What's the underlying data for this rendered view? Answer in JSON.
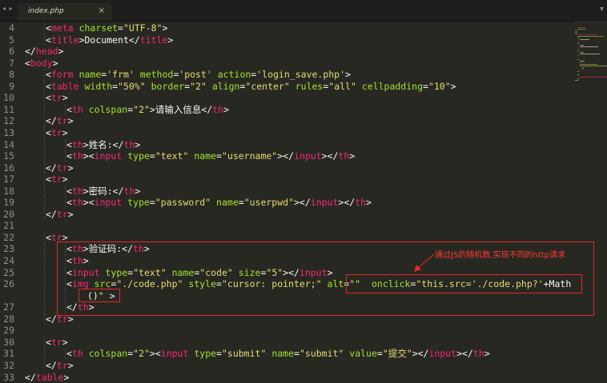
{
  "tab": {
    "label": "index.php",
    "close": "×"
  },
  "window": {
    "nav": "◂ ▸",
    "menu": "▾"
  },
  "colors": {
    "background": "#272822",
    "tag": "#f92672",
    "attr": "#a6e22e",
    "string": "#e6db74",
    "text": "#f8f8f2",
    "line_number": "#8f908a",
    "annotation": "#e8262a"
  },
  "annotation": {
    "text": "通过JS的随机数,实现不同的http请求"
  },
  "lines": [
    {
      "n": "4",
      "indent": 1,
      "tokens": [
        [
          "p",
          "<"
        ],
        [
          "t",
          "meta"
        ],
        [
          "w",
          " "
        ],
        [
          "a",
          "charset"
        ],
        [
          "p",
          "="
        ],
        [
          "s",
          "\"UTF-8\""
        ],
        [
          "p",
          ">"
        ]
      ]
    },
    {
      "n": "5",
      "indent": 1,
      "tokens": [
        [
          "p",
          "<"
        ],
        [
          "t",
          "title"
        ],
        [
          "p",
          ">"
        ],
        [
          "w",
          "Document"
        ],
        [
          "p",
          "</"
        ],
        [
          "t",
          "title"
        ],
        [
          "p",
          ">"
        ]
      ]
    },
    {
      "n": "6",
      "indent": 0,
      "tokens": [
        [
          "p",
          "</"
        ],
        [
          "t",
          "head"
        ],
        [
          "p",
          ">"
        ]
      ]
    },
    {
      "n": "7",
      "indent": 0,
      "tokens": [
        [
          "p",
          "<"
        ],
        [
          "t",
          "body"
        ],
        [
          "p",
          ">"
        ]
      ]
    },
    {
      "n": "8",
      "indent": 1,
      "tokens": [
        [
          "p",
          "<"
        ],
        [
          "t",
          "form"
        ],
        [
          "w",
          " "
        ],
        [
          "a",
          "name"
        ],
        [
          "p",
          "="
        ],
        [
          "s",
          "'frm'"
        ],
        [
          "w",
          " "
        ],
        [
          "a",
          "method"
        ],
        [
          "p",
          "="
        ],
        [
          "s",
          "'post'"
        ],
        [
          "w",
          " "
        ],
        [
          "a",
          "action"
        ],
        [
          "p",
          "="
        ],
        [
          "s",
          "'login_save.php'"
        ],
        [
          "p",
          ">"
        ]
      ]
    },
    {
      "n": "9",
      "indent": 1,
      "tokens": [
        [
          "p",
          "<"
        ],
        [
          "t",
          "table"
        ],
        [
          "w",
          " "
        ],
        [
          "a",
          "width"
        ],
        [
          "p",
          "="
        ],
        [
          "s",
          "\"50%\""
        ],
        [
          "w",
          " "
        ],
        [
          "a",
          "border"
        ],
        [
          "p",
          "="
        ],
        [
          "s",
          "\"2\""
        ],
        [
          "w",
          " "
        ],
        [
          "a",
          "align"
        ],
        [
          "p",
          "="
        ],
        [
          "s",
          "\"center\""
        ],
        [
          "w",
          " "
        ],
        [
          "a",
          "rules"
        ],
        [
          "p",
          "="
        ],
        [
          "s",
          "\"all\""
        ],
        [
          "w",
          " "
        ],
        [
          "a",
          "cellpadding"
        ],
        [
          "p",
          "="
        ],
        [
          "s",
          "\"10\""
        ],
        [
          "p",
          ">"
        ]
      ]
    },
    {
      "n": "10",
      "indent": 1,
      "tokens": [
        [
          "p",
          "<"
        ],
        [
          "t",
          "tr"
        ],
        [
          "p",
          ">"
        ]
      ]
    },
    {
      "n": "11",
      "indent": 2,
      "tokens": [
        [
          "p",
          "<"
        ],
        [
          "t",
          "th"
        ],
        [
          "w",
          " "
        ],
        [
          "a",
          "colspan"
        ],
        [
          "p",
          "="
        ],
        [
          "s",
          "\"2\""
        ],
        [
          "p",
          ">"
        ],
        [
          "w",
          "请输入信息"
        ],
        [
          "p",
          "</"
        ],
        [
          "t",
          "th"
        ],
        [
          "p",
          ">"
        ]
      ]
    },
    {
      "n": "12",
      "indent": 1,
      "tokens": [
        [
          "p",
          "</"
        ],
        [
          "t",
          "tr"
        ],
        [
          "p",
          ">"
        ]
      ]
    },
    {
      "n": "13",
      "indent": 1,
      "tokens": [
        [
          "p",
          "<"
        ],
        [
          "t",
          "tr"
        ],
        [
          "p",
          ">"
        ]
      ]
    },
    {
      "n": "14",
      "indent": 2,
      "tokens": [
        [
          "p",
          "<"
        ],
        [
          "t",
          "th"
        ],
        [
          "p",
          ">"
        ],
        [
          "w",
          "姓名:"
        ],
        [
          "p",
          "</"
        ],
        [
          "t",
          "th"
        ],
        [
          "p",
          ">"
        ]
      ]
    },
    {
      "n": "15",
      "indent": 2,
      "tokens": [
        [
          "p",
          "<"
        ],
        [
          "t",
          "th"
        ],
        [
          "p",
          "><"
        ],
        [
          "t",
          "input"
        ],
        [
          "w",
          " "
        ],
        [
          "a",
          "type"
        ],
        [
          "p",
          "="
        ],
        [
          "s",
          "\"text\""
        ],
        [
          "w",
          " "
        ],
        [
          "a",
          "name"
        ],
        [
          "p",
          "="
        ],
        [
          "s",
          "\"username\""
        ],
        [
          "p",
          "></"
        ],
        [
          "t",
          "input"
        ],
        [
          "p",
          "></"
        ],
        [
          "t",
          "th"
        ],
        [
          "p",
          ">"
        ]
      ]
    },
    {
      "n": "16",
      "indent": 1,
      "tokens": [
        [
          "p",
          "</"
        ],
        [
          "t",
          "tr"
        ],
        [
          "p",
          ">"
        ]
      ]
    },
    {
      "n": "17",
      "indent": 1,
      "tokens": [
        [
          "p",
          "<"
        ],
        [
          "t",
          "tr"
        ],
        [
          "p",
          ">"
        ]
      ]
    },
    {
      "n": "18",
      "indent": 2,
      "tokens": [
        [
          "p",
          "<"
        ],
        [
          "t",
          "th"
        ],
        [
          "p",
          ">"
        ],
        [
          "w",
          "密码:"
        ],
        [
          "p",
          "</"
        ],
        [
          "t",
          "th"
        ],
        [
          "p",
          ">"
        ]
      ]
    },
    {
      "n": "19",
      "indent": 2,
      "tokens": [
        [
          "p",
          "<"
        ],
        [
          "t",
          "th"
        ],
        [
          "p",
          "><"
        ],
        [
          "t",
          "input"
        ],
        [
          "w",
          " "
        ],
        [
          "a",
          "type"
        ],
        [
          "p",
          "="
        ],
        [
          "s",
          "\"password\""
        ],
        [
          "w",
          " "
        ],
        [
          "a",
          "name"
        ],
        [
          "p",
          "="
        ],
        [
          "s",
          "\"userpwd\""
        ],
        [
          "p",
          "></"
        ],
        [
          "t",
          "input"
        ],
        [
          "p",
          "></"
        ],
        [
          "t",
          "th"
        ],
        [
          "p",
          ">"
        ]
      ]
    },
    {
      "n": "20",
      "indent": 1,
      "tokens": [
        [
          "p",
          "</"
        ],
        [
          "t",
          "tr"
        ],
        [
          "p",
          ">"
        ]
      ]
    },
    {
      "n": "21",
      "indent": 0,
      "tokens": []
    },
    {
      "n": "22",
      "indent": 1,
      "tokens": [
        [
          "p",
          "<"
        ],
        [
          "t",
          "tr"
        ],
        [
          "p",
          ">"
        ]
      ]
    },
    {
      "n": "23",
      "indent": 2,
      "tokens": [
        [
          "p",
          "<"
        ],
        [
          "t",
          "th"
        ],
        [
          "p",
          ">"
        ],
        [
          "w",
          "验证码:"
        ],
        [
          "p",
          "</"
        ],
        [
          "t",
          "th"
        ],
        [
          "p",
          ">"
        ]
      ]
    },
    {
      "n": "24",
      "indent": 2,
      "tokens": [
        [
          "p",
          "<"
        ],
        [
          "t",
          "th"
        ],
        [
          "p",
          ">"
        ]
      ]
    },
    {
      "n": "25",
      "indent": 2,
      "tokens": [
        [
          "p",
          "<"
        ],
        [
          "t",
          "input"
        ],
        [
          "w",
          " "
        ],
        [
          "a",
          "type"
        ],
        [
          "p",
          "="
        ],
        [
          "s",
          "\"text\""
        ],
        [
          "w",
          " "
        ],
        [
          "a",
          "name"
        ],
        [
          "p",
          "="
        ],
        [
          "s",
          "\"code\""
        ],
        [
          "w",
          " "
        ],
        [
          "a",
          "size"
        ],
        [
          "p",
          "="
        ],
        [
          "s",
          "\"5\""
        ],
        [
          "p",
          "></"
        ],
        [
          "t",
          "input"
        ],
        [
          "p",
          ">"
        ]
      ]
    },
    {
      "n": "26",
      "indent": 2,
      "tokens": [
        [
          "p",
          "<"
        ],
        [
          "t",
          "img"
        ],
        [
          "w",
          " "
        ],
        [
          "a",
          "src"
        ],
        [
          "p",
          "="
        ],
        [
          "s",
          "\"./code.php\""
        ],
        [
          "w",
          " "
        ],
        [
          "a",
          "style"
        ],
        [
          "p",
          "="
        ],
        [
          "s",
          "\"cursor: pointer;\""
        ],
        [
          "w",
          " "
        ],
        [
          "a",
          "alt"
        ],
        [
          "p",
          "="
        ],
        [
          "s",
          "\"\""
        ],
        [
          "w",
          "  "
        ],
        [
          "a",
          "onclick"
        ],
        [
          "p",
          "="
        ],
        [
          "s",
          "\"this.src='./code.php?'"
        ],
        [
          "w",
          "+Math.random"
        ]
      ]
    },
    {
      "n": "",
      "indent": 3,
      "tokens": [
        [
          "w",
          "()"
        ],
        [
          "s",
          "\""
        ],
        [
          "w",
          " "
        ],
        [
          "p",
          ">"
        ]
      ]
    },
    {
      "n": "27",
      "indent": 2,
      "tokens": [
        [
          "p",
          "</"
        ],
        [
          "t",
          "th"
        ],
        [
          "p",
          ">"
        ]
      ]
    },
    {
      "n": "28",
      "indent": 1,
      "tokens": [
        [
          "p",
          "</"
        ],
        [
          "t",
          "tr"
        ],
        [
          "p",
          ">"
        ]
      ]
    },
    {
      "n": "29",
      "indent": 0,
      "tokens": []
    },
    {
      "n": "30",
      "indent": 1,
      "tokens": [
        [
          "p",
          "<"
        ],
        [
          "t",
          "tr"
        ],
        [
          "p",
          ">"
        ]
      ]
    },
    {
      "n": "31",
      "indent": 2,
      "tokens": [
        [
          "p",
          "<"
        ],
        [
          "t",
          "th"
        ],
        [
          "w",
          " "
        ],
        [
          "a",
          "colspan"
        ],
        [
          "p",
          "="
        ],
        [
          "s",
          "\"2\""
        ],
        [
          "p",
          "><"
        ],
        [
          "t",
          "input"
        ],
        [
          "w",
          " "
        ],
        [
          "a",
          "type"
        ],
        [
          "p",
          "="
        ],
        [
          "s",
          "\"submit\""
        ],
        [
          "w",
          " "
        ],
        [
          "a",
          "name"
        ],
        [
          "p",
          "="
        ],
        [
          "s",
          "\"submit\""
        ],
        [
          "w",
          " "
        ],
        [
          "a",
          "value"
        ],
        [
          "p",
          "="
        ],
        [
          "s",
          "\"提交\""
        ],
        [
          "p",
          "></"
        ],
        [
          "t",
          "input"
        ],
        [
          "p",
          "></"
        ],
        [
          "t",
          "th"
        ],
        [
          "p",
          ">"
        ]
      ]
    },
    {
      "n": "32",
      "indent": 1,
      "tokens": [
        [
          "p",
          "</"
        ],
        [
          "t",
          "tr"
        ],
        [
          "p",
          ">"
        ]
      ]
    },
    {
      "n": "33",
      "indent": 0,
      "tokens": [
        [
          "p",
          "</"
        ],
        [
          "t",
          "table"
        ],
        [
          "p",
          ">"
        ]
      ]
    }
  ]
}
